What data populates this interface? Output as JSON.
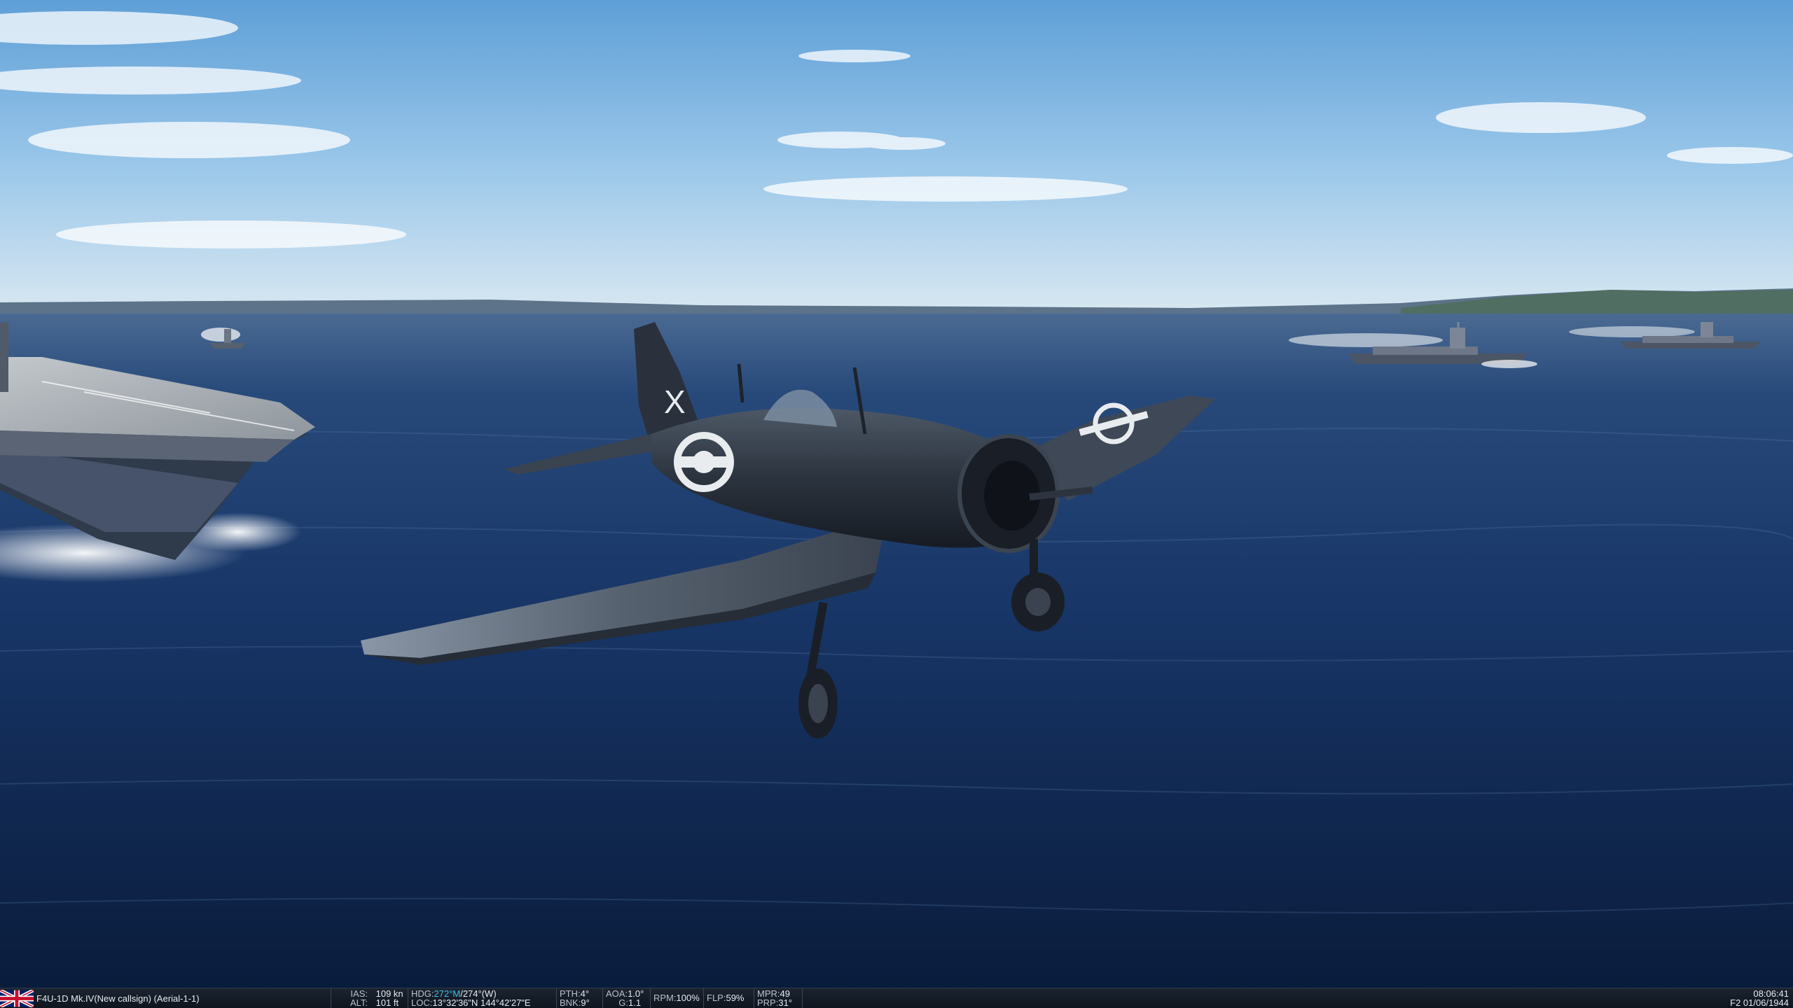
{
  "hud": {
    "aircraft": "F4U-1D Mk.IV(New callsign) (Aerial-1-1)",
    "ias_label": "IAS:",
    "ias_value": "109 kn",
    "alt_label": "ALT:",
    "alt_value": "101 ft",
    "hdg_label": "HDG:",
    "hdg_mag": "272°M",
    "hdg_true": "/274°(W)",
    "loc_label": "LOC:",
    "loc_value": "13°32'36\"N 144°42'27\"E",
    "pth_label": "PTH:",
    "pth_value": "4°",
    "bnk_label": "BNK:",
    "bnk_value": "9°",
    "aoa_label": "AOA:",
    "aoa_value": "1.0°",
    "g_label": "G:",
    "g_value": "1.1",
    "rpm_label": "RPM:",
    "rpm_value": "100%",
    "flp_label": "FLP:",
    "flp_value": "59%",
    "mpr_label": "MPR:",
    "mpr_value": "49",
    "prp_label": "PRP:",
    "prp_value": "31°",
    "time": "08:06:41",
    "date": "F2 01/06/1944"
  },
  "colors": {
    "accent": "#3fc0e6",
    "statusbar_bg": "#141b26",
    "sea": "#0d2750",
    "sky": "#7fb4e2"
  },
  "scene": {
    "aircraft_marking": "X",
    "flag": "union-jack-icon"
  }
}
